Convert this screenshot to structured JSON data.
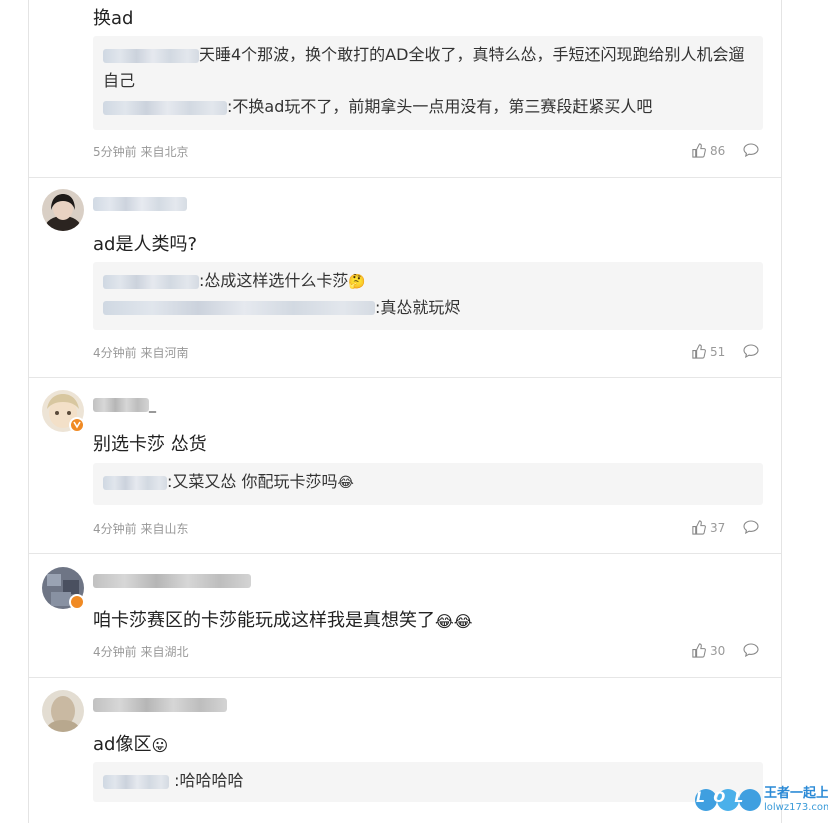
{
  "comments": [
    {
      "text": "换ad",
      "replies": [
        {
          "sep": "",
          "text": "天睡4个那波，换个敢打的AD全收了，真特么怂，手短还闪现跑给别人机会遛自己"
        },
        {
          "sep": ":",
          "text": "不换ad玩不了，前期拿头一点用没有，第三赛段赶紧买人吧"
        }
      ],
      "time": "5分钟前 来自北京",
      "likes": "86"
    },
    {
      "text": "ad是人类吗?",
      "replies": [
        {
          "sep": ":",
          "text": "怂成这样选什么卡莎",
          "emoji": "🤔"
        },
        {
          "sep": ":",
          "text": "真怂就玩烬"
        }
      ],
      "time": "4分钟前 来自河南",
      "likes": "51"
    },
    {
      "name_suffix": "_",
      "text": "别选卡莎 怂货",
      "replies": [
        {
          "sep": ":",
          "text": "又菜又怂 你配玩卡莎吗",
          "emoji": "😂"
        }
      ],
      "time": "4分钟前 来自山东",
      "likes": "37"
    },
    {
      "text": "咱卡莎赛区的卡莎能玩成这样我是真想笑了",
      "emoji": "😂😂",
      "time": "4分钟前 来自湖北",
      "likes": "30"
    },
    {
      "text": "ad像区",
      "emoji": "😛",
      "replies": [
        {
          "sep": ":",
          "text": "哈哈哈哈"
        }
      ]
    }
  ],
  "icons": {
    "like": "thumb-up-icon",
    "comment": "comment-bubble-icon"
  },
  "watermark": {
    "logo": "LOL",
    "cn": "王者一起上",
    "url": "lolwz173.com"
  }
}
